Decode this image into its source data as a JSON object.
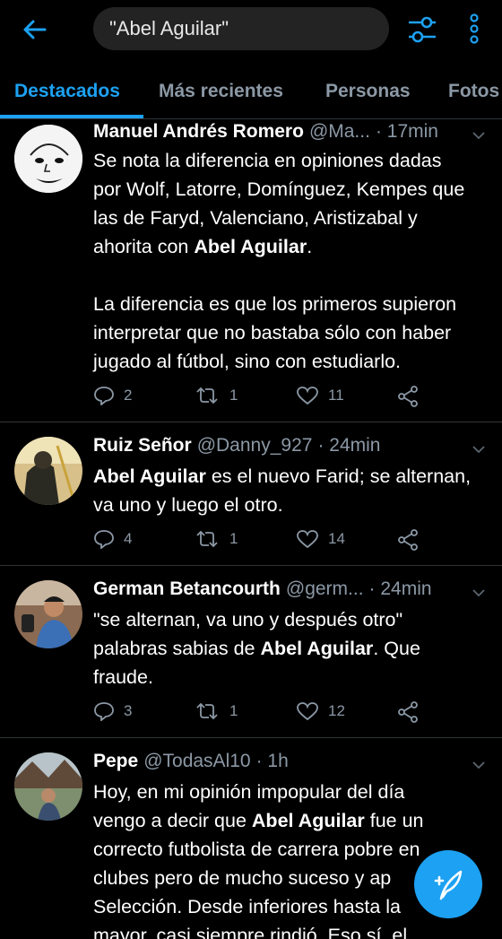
{
  "search": {
    "query": "\"Abel Aguilar\""
  },
  "tabs": [
    {
      "label": "Destacados"
    },
    {
      "label": "Más recientes"
    },
    {
      "label": "Personas"
    },
    {
      "label": "Fotos"
    }
  ],
  "tweets": [
    {
      "name": "Manuel Andrés Romero",
      "handle": "@Ma...",
      "time": "· 17min",
      "line1": "Se nota la diferencia en opiniones dadas",
      "line2": "por Wolf, Latorre, Domínguez, Kempes que",
      "line3": "las de Faryd, Valenciano, Aristizabal y",
      "line4a": "ahorita con ",
      "line4b": "Abel Aguilar",
      "line4c": ".",
      "line5": "La diferencia es que los primeros supieron",
      "line6": "interpretar que no bastaba sólo con haber",
      "line7": "jugado al fútbol, sino con estudiarlo.",
      "replies": "2",
      "retweets": "1",
      "likes": "11"
    },
    {
      "name": "Ruiz Señor",
      "handle": "@Danny_927",
      "time": "· 24min",
      "line1b": "Abel Aguilar",
      "line1c": " es el nuevo Farid; se alternan,",
      "line2": "va uno y luego el otro.",
      "replies": "4",
      "retweets": "1",
      "likes": "14"
    },
    {
      "name": "German Betancourth",
      "handle": "@germ...",
      "time": "· 24min",
      "line1": "\"se alternan, va uno y después otro\"",
      "line2a": "palabras sabias de ",
      "line2b": "Abel Aguilar",
      "line2c": ". Que",
      "line3": "fraude.",
      "replies": "3",
      "retweets": "1",
      "likes": "12"
    },
    {
      "name": "Pepe",
      "handle": "@TodasAl10",
      "time": "· 1h",
      "line1": "Hoy, en mi opinión impopular del día",
      "line2a": "vengo a decir que ",
      "line2b": "Abel Aguilar",
      "line2c": " fue un",
      "line3": "correcto futbolista de carrera pobre en",
      "line4": "clubes pero de mucho suceso y ap",
      "line5": "Selección. Desde inferiores hasta la",
      "line6": "mayor, casi siempre rindió. Eso sí, el"
    }
  ],
  "colors": {
    "accent": "#1da1f2",
    "muted": "#8b98a5",
    "background": "#000000"
  }
}
